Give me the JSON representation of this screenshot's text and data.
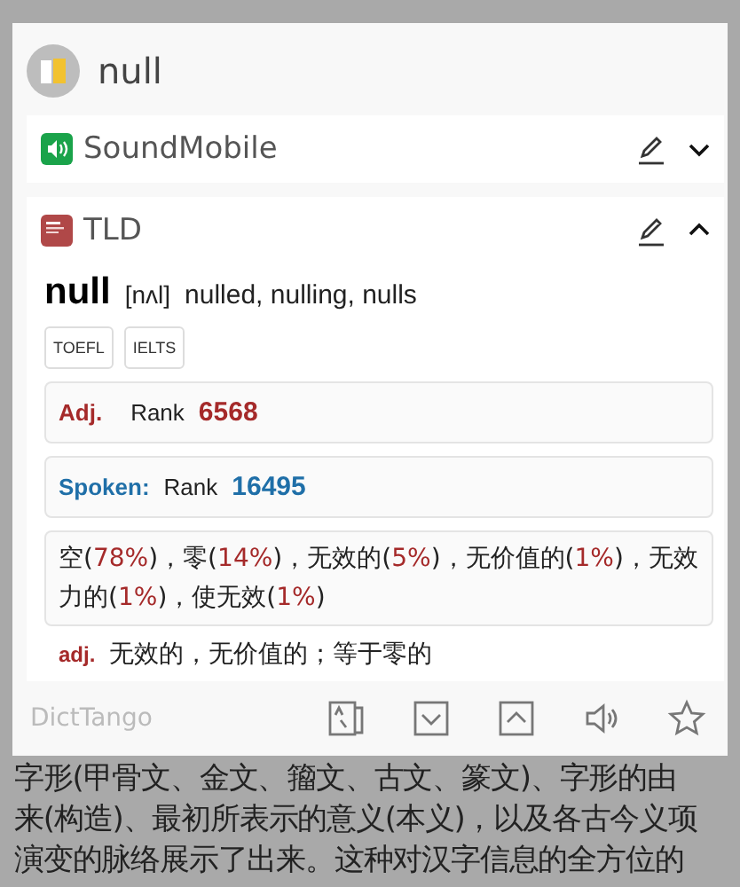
{
  "search": {
    "query": "null"
  },
  "dictionaries": [
    {
      "name": "SoundMobile",
      "kind": "sound",
      "expanded": false
    },
    {
      "name": "TLD",
      "kind": "book",
      "expanded": true
    }
  ],
  "entry": {
    "headword": "null",
    "phonetic": "[nʌl]",
    "forms": "nulled, nulling, nulls",
    "tags": [
      "TOEFL",
      "IELTS"
    ],
    "ranks": [
      {
        "label": "Adj.",
        "word": "Rank",
        "value": "6568",
        "color": "#a52a2a"
      },
      {
        "label": "Spoken:",
        "word": "Rank",
        "value": "16495",
        "color": "#1f6fa8"
      }
    ],
    "meanings": [
      {
        "text": "空(",
        "kind": "plain"
      },
      {
        "text": "78%",
        "kind": "pct"
      },
      {
        "text": ")，零(",
        "kind": "plain"
      },
      {
        "text": "14%",
        "kind": "pct"
      },
      {
        "text": ")，无效的(",
        "kind": "plain"
      },
      {
        "text": "5%",
        "kind": "pct"
      },
      {
        "text": ")，无价值的(",
        "kind": "plain"
      },
      {
        "text": "1%",
        "kind": "pct"
      },
      {
        "text": ")，无效力的(",
        "kind": "plain"
      },
      {
        "text": "1%",
        "kind": "pct"
      },
      {
        "text": ")，使无效(",
        "kind": "plain"
      },
      {
        "text": "1%",
        "kind": "pct"
      },
      {
        "text": ")",
        "kind": "plain"
      }
    ],
    "definition": {
      "pos": "adj.",
      "text": "无效的，无价值的；等于零的"
    }
  },
  "footer": {
    "brand": "DictTango"
  },
  "background_text": [
    "字形(甲骨文、金文、籀文、古文、篆文)、字形的由",
    "来(构造)、最初所表示的意义(本义)，以及各古今义项",
    "演变的脉络展示了出来。这种对汉字信息的全方位的"
  ]
}
